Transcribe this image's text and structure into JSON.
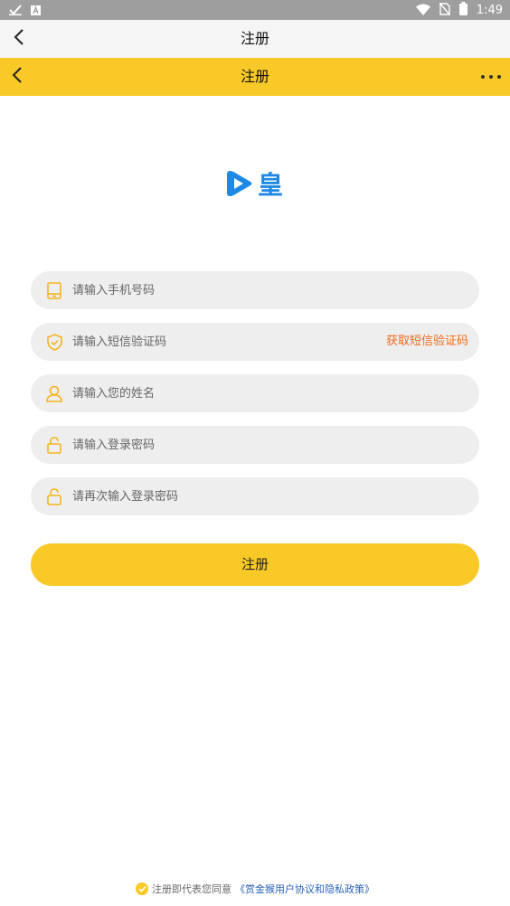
{
  "status_bar": {
    "time": "1:49",
    "icons": [
      "check-icon",
      "a-badge-icon",
      "wifi-icon",
      "no-sim-icon",
      "battery-icon"
    ]
  },
  "appbar": {
    "title": "注册",
    "back_icon": "chevron-left-icon"
  },
  "yellowbar": {
    "title": "注册",
    "back_icon": "chevron-left-icon",
    "more_icon": "more-dots-icon"
  },
  "logo": {
    "text": "皇",
    "icon": "play-logo-icon",
    "color": "#1e88e5"
  },
  "form": {
    "phone": {
      "placeholder": "请输入手机号码",
      "value": "",
      "icon": "phone-icon"
    },
    "sms_code": {
      "placeholder": "请输入短信验证码",
      "value": "",
      "icon": "shield-icon",
      "action_label": "获取短信验证码"
    },
    "name": {
      "placeholder": "请输入您的姓名",
      "value": "",
      "icon": "user-icon"
    },
    "password": {
      "placeholder": "请输入登录密码",
      "value": "",
      "icon": "lock-icon"
    },
    "password_confirm": {
      "placeholder": "请再次输入登录密码",
      "value": "",
      "icon": "lock-icon"
    }
  },
  "register_button": {
    "label": "注册"
  },
  "agreement": {
    "checked": true,
    "text": "注册即代表您同意",
    "link": "《赏金猴用户协议和隐私政策》"
  },
  "colors": {
    "accent": "#f9c927",
    "link": "#f26b1d",
    "agreement_link": "#2a62b8",
    "logo": "#1e88e5"
  }
}
